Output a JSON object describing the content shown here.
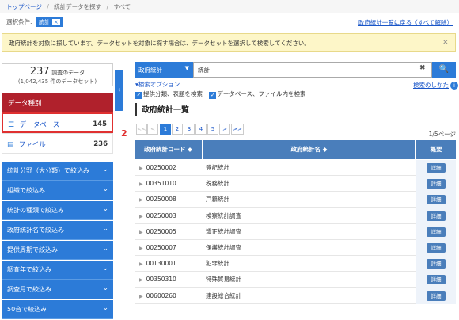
{
  "breadcrumb": {
    "home": "トップページ",
    "search": "統計データを探す",
    "current": "すべて"
  },
  "conditions": {
    "label": "選択条件:",
    "badge": "統計",
    "badge_close": "×",
    "back_link": "政府統計一覧に戻る（すべて解除）"
  },
  "banner": {
    "text": "政府統計を対象に探しています。データセットを対象に探す場合は、データセットを選択して検索してください。",
    "close": "×"
  },
  "sidebar": {
    "count_number": "237",
    "count_unit": "調査のデータ",
    "count_sub": "(1,042,435 件のデータセット)",
    "collapse_glyph": "‹",
    "data_type_header": "データ種別",
    "data_types": [
      {
        "label": "データベース",
        "count": "145"
      },
      {
        "label": "ファイル",
        "count": "236"
      }
    ],
    "marker": "2",
    "filters": [
      "統計分野（大分類）で絞込み",
      "組織で絞込み",
      "統計の種類で絞込み",
      "政府統計名で絞込み",
      "提供周期で絞込み",
      "調査年で絞込み",
      "調査月で絞込み",
      "50音で絞込み"
    ]
  },
  "search": {
    "scope": "政府統計",
    "scope_caret": "▼",
    "query": "統計",
    "clear": "✖",
    "go_glyph": "🔍",
    "options_link": "▾検索オプション",
    "howto": "検索のしかた",
    "howto_icon": "i",
    "check1": "提供分類、表題を検索",
    "check2": "データベース、ファイル内を検索"
  },
  "section_title": "政府統計一覧",
  "pagination": {
    "first": "<<",
    "prev": "<",
    "pages": [
      "1",
      "2",
      "3",
      "4",
      "5"
    ],
    "current": "1",
    "next": ">",
    "last": ">>",
    "info": "1/5ページ"
  },
  "table": {
    "col_code": "政府統計コード ◆",
    "col_name": "政府統計名 ◆",
    "col_detail": "概要",
    "detail_label": "詳細",
    "row_arrow": "▶",
    "rows": [
      {
        "code": "00250002",
        "name": "登記統計"
      },
      {
        "code": "00351010",
        "name": "税務統計"
      },
      {
        "code": "00250008",
        "name": "戸籍統計"
      },
      {
        "code": "00250003",
        "name": "検察統計調査"
      },
      {
        "code": "00250005",
        "name": "矯正統計調査"
      },
      {
        "code": "00250007",
        "name": "保護統計調査"
      },
      {
        "code": "00130001",
        "name": "犯罪統計"
      },
      {
        "code": "00350310",
        "name": "特殊貿易統計"
      },
      {
        "code": "00600260",
        "name": "建設総合統計"
      }
    ]
  }
}
